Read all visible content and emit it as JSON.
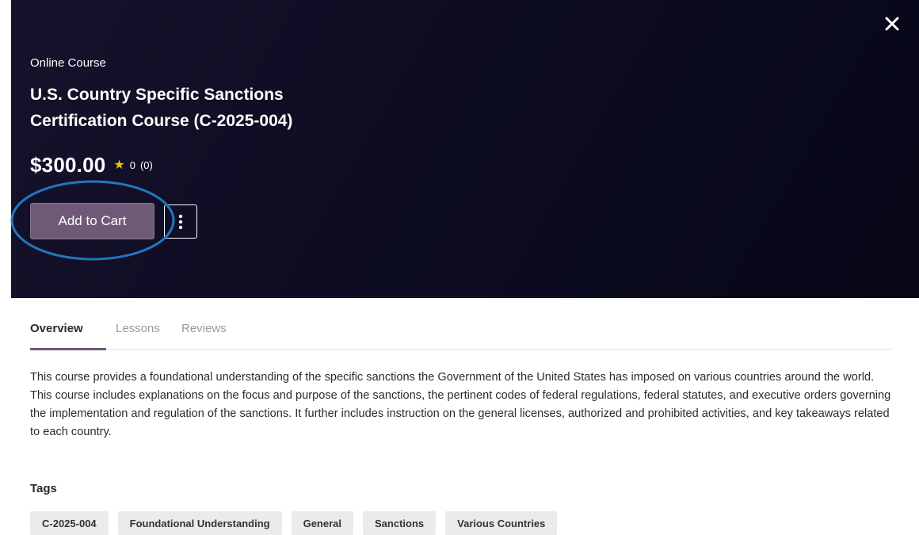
{
  "modal": {
    "close_icon": "close-icon",
    "kicker": "Online Course",
    "title": "U.S. Country Specific Sanctions Certification Course (C-2025-004)",
    "price": "$300.00",
    "rating_value": "0",
    "rating_count": "(0)",
    "star_icon": "star-icon",
    "add_to_cart_label": "Add to Cart",
    "more_icon": "kebab-menu-icon",
    "colors": {
      "hero_bg": "#0d0c22",
      "button_bg": "#6e5a76",
      "highlight_ring": "#1f79c0",
      "star": "#f2c200"
    }
  },
  "tabs": [
    {
      "label": "Overview",
      "active": true
    },
    {
      "label": "Lessons",
      "active": false
    },
    {
      "label": "Reviews",
      "active": false
    }
  ],
  "overview": {
    "description": "This course provides a foundational understanding of the specific sanctions the Government of the United States has imposed on various countries around the world. This course includes explanations on the focus and purpose of the sanctions, the pertinent codes of federal regulations, federal statutes, and executive orders governing the implementation and regulation of the sanctions. It further includes instruction on the general licenses, authorized and prohibited activities, and key takeaways related to each country.",
    "tags_heading": "Tags",
    "tags": [
      "C-2025-004",
      "Foundational Understanding",
      "General",
      "Sanctions",
      "Various Countries"
    ]
  }
}
